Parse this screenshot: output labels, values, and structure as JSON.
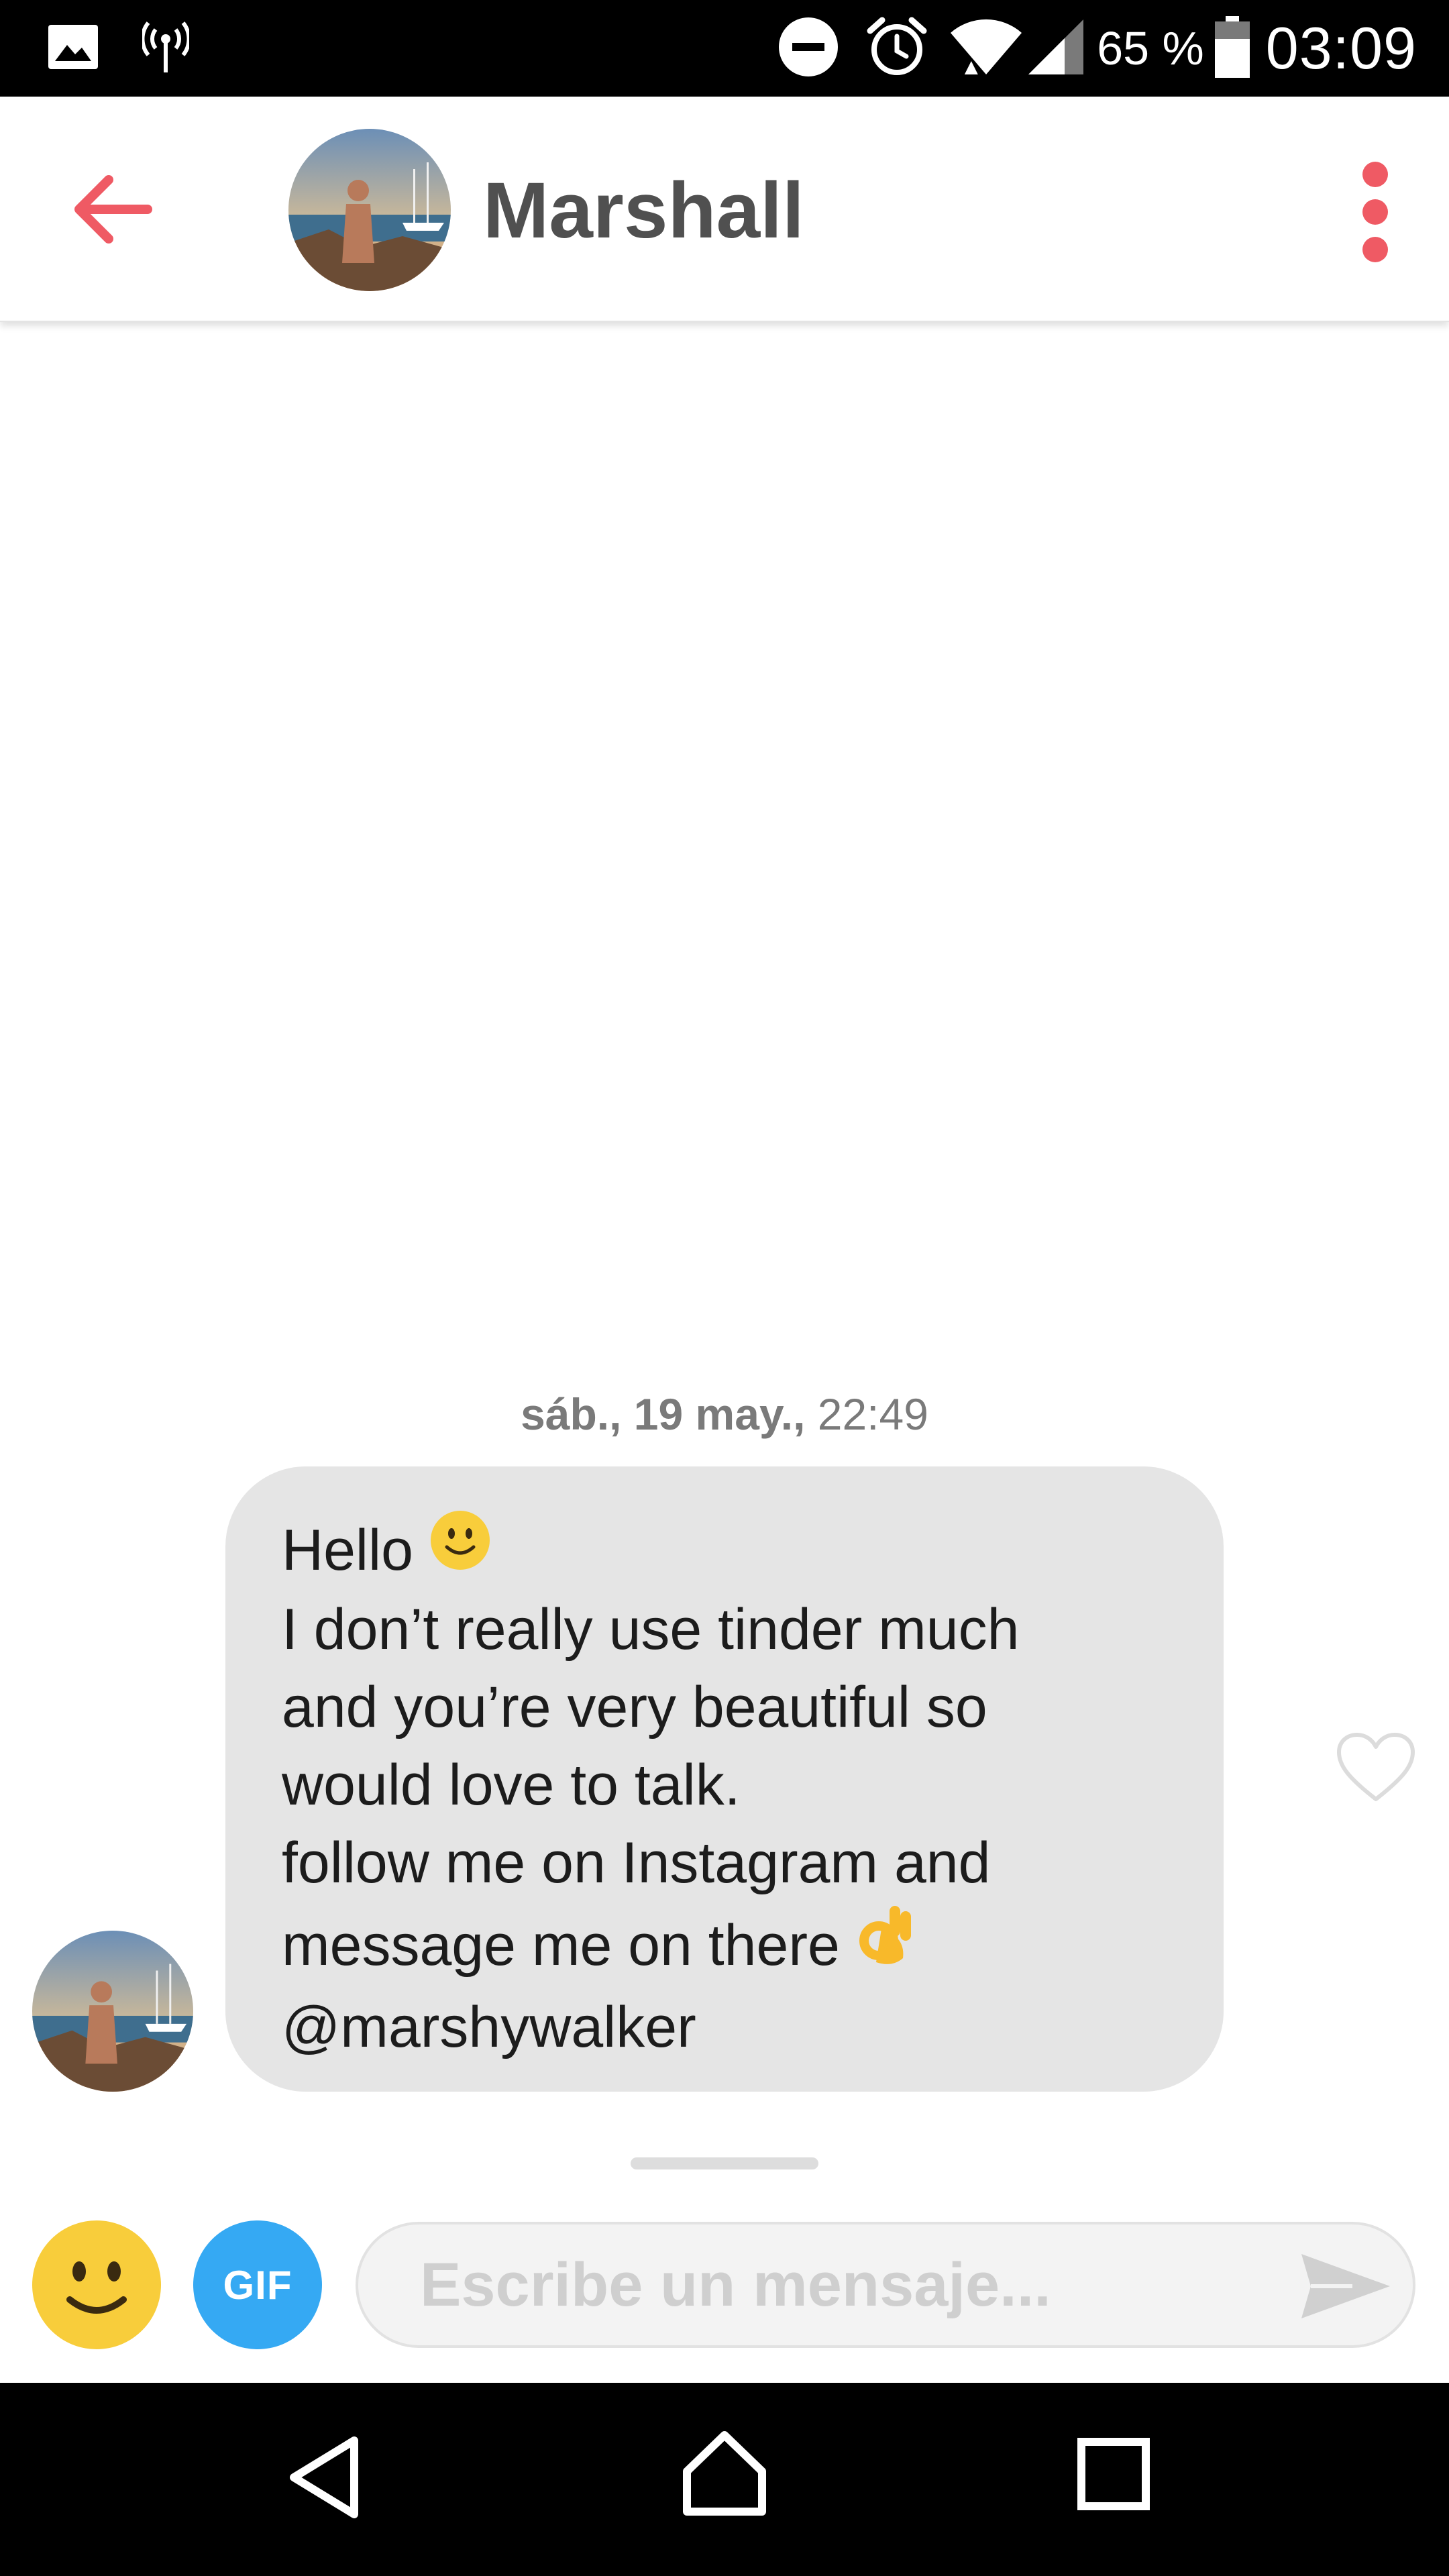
{
  "status_bar": {
    "battery_percent": "65 %",
    "battery_level": 0.65,
    "time": "03:09",
    "icons": [
      "image-icon",
      "hotspot-icon",
      "do-not-disturb-icon",
      "alarm-icon",
      "wifi-icon",
      "signal-icon",
      "battery-icon"
    ]
  },
  "header": {
    "name": "Marshall",
    "accent_color": "#ef5a64",
    "icons": [
      "back-arrow-icon",
      "more-vertical-icon"
    ]
  },
  "conversation": {
    "timestamp_bold": "sáb., 19 may.,",
    "timestamp_time": "22:49",
    "message_lines": [
      "Hello",
      "I don’t really use tinder much",
      "and you’re very beautiful so",
      "would love to talk.",
      "follow me on Instagram and",
      "message me on there",
      "@marshywalker"
    ],
    "emojis": [
      "slightly-smiling-face",
      "ok-hand"
    ],
    "liked": false
  },
  "composer": {
    "gif_label": "GIF",
    "placeholder": "Escribe un mensaje...",
    "value": "",
    "gif_color": "#35a9f3",
    "emoji_color": "#f8cd3b"
  },
  "nav_bar": {
    "icons": [
      "nav-back-icon",
      "nav-home-icon",
      "nav-recents-icon"
    ]
  }
}
